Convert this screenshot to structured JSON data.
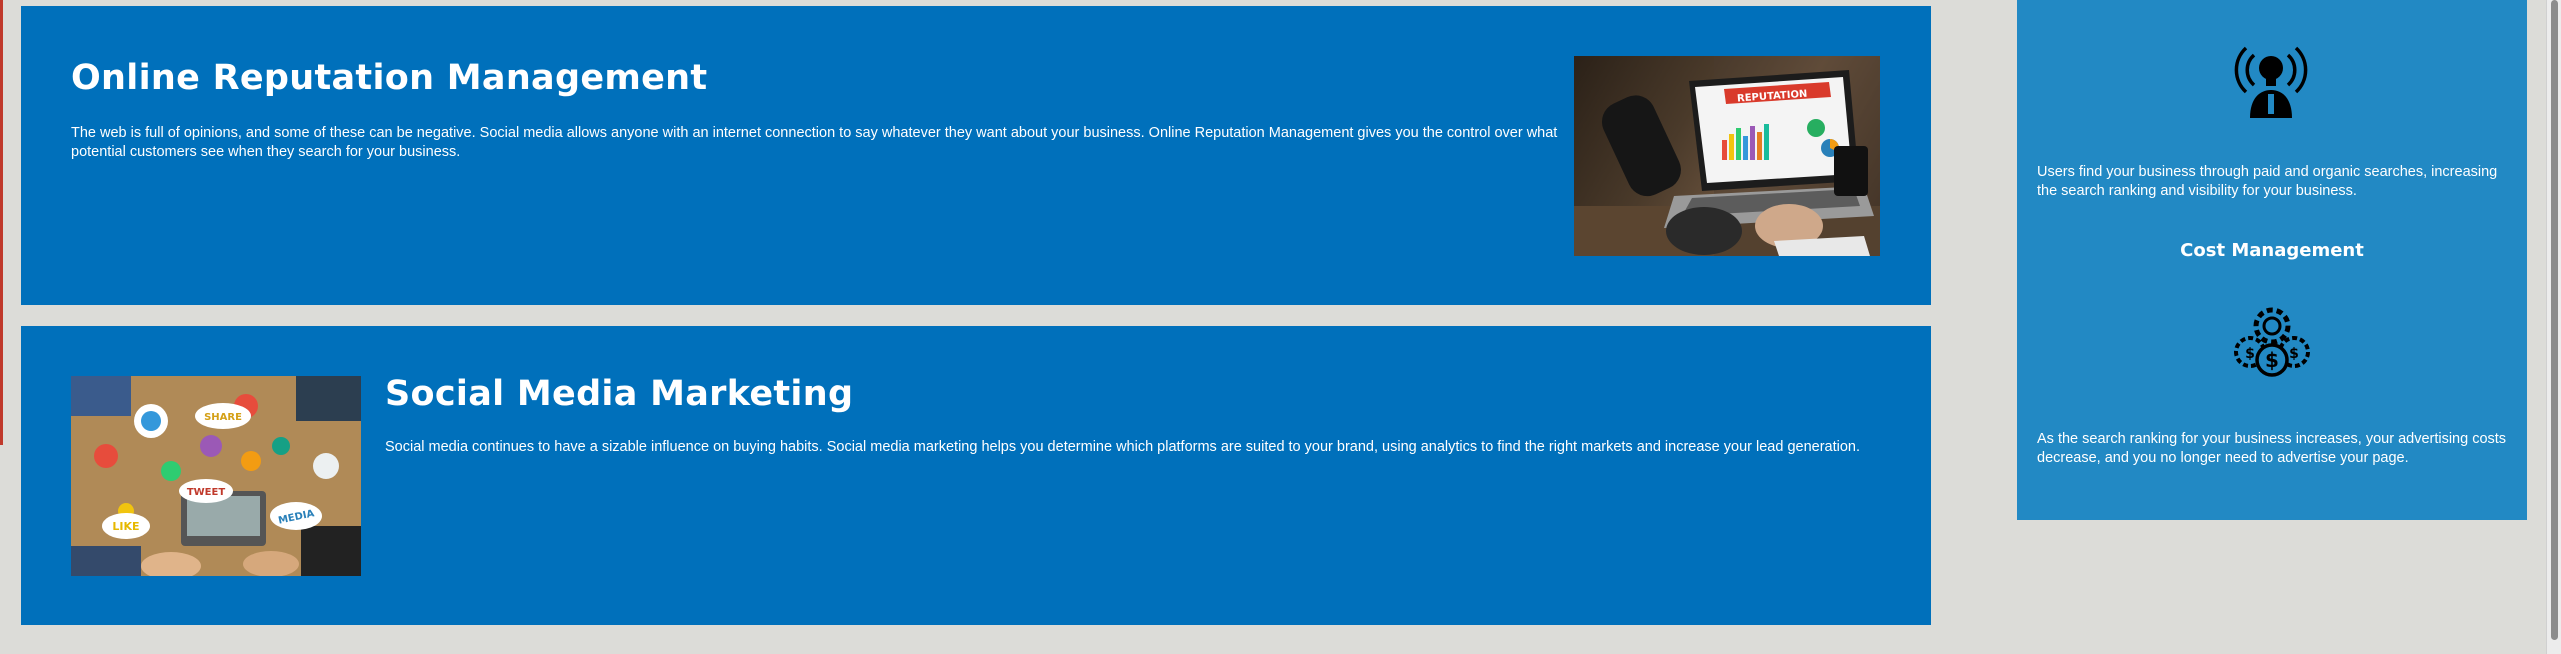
{
  "panels": {
    "orm": {
      "title": "Online Reputation Management",
      "body": "The web is full of opinions, and some of these can be negative. Social media allows anyone with an internet connection to say whatever they want about your business. Online Reputation Management gives you the control over what potential customers see when they search for your business.",
      "photo_sign": "REPUTATION"
    },
    "smm": {
      "title": "Social Media Marketing",
      "body": "Social media continues to have a sizable influence on buying habits. Social media marketing helps you determine which platforms are suited to your brand, using analytics to find the right markets and increase your lead generation.",
      "bubbles": [
        "SHARE",
        "TWEET",
        "LIKE",
        "MEDIA"
      ]
    }
  },
  "sidebar": {
    "text_1": "Users find your business through paid and organic searches, increasing the search ranking and visibility for your business.",
    "heading": "Cost Management",
    "text_2": "As the search ranking for your business increases, your advertising costs decrease, and you no longer need to advertise your page."
  },
  "colors": {
    "panel": "#0070bb",
    "sidebar": "#2289c4",
    "background": "#dcdcd8"
  }
}
